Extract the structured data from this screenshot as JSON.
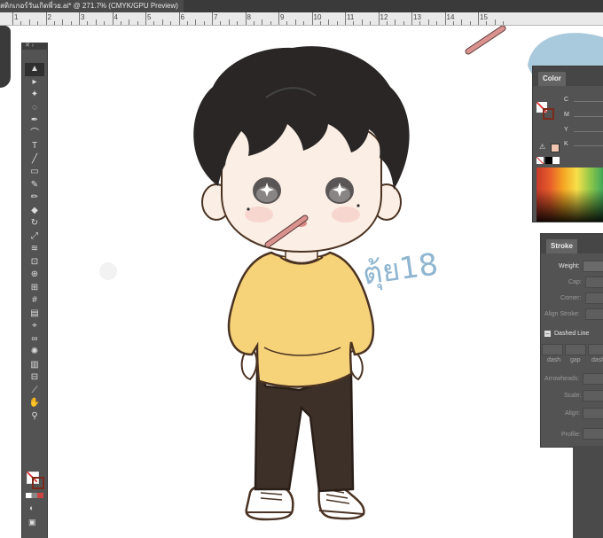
{
  "document_tab": {
    "title": "สติกเกอร์วันเกิดพี่วย.ai* @ 271.7% (CMYK/GPU Preview)"
  },
  "ruler": {
    "numbers": [
      "1",
      "2",
      "3",
      "4",
      "5",
      "6",
      "7",
      "8",
      "9",
      "10",
      "11",
      "12",
      "13",
      "14",
      "15"
    ]
  },
  "tools": {
    "items": [
      {
        "name": "selection-tool",
        "glyph": "▲",
        "selected": true
      },
      {
        "name": "direct-selection-tool",
        "glyph": "▸"
      },
      {
        "name": "magic-wand-tool",
        "glyph": "✦"
      },
      {
        "name": "lasso-tool",
        "glyph": "◌"
      },
      {
        "name": "pen-tool",
        "glyph": "✒"
      },
      {
        "name": "curvature-tool",
        "glyph": "⌒"
      },
      {
        "name": "type-tool",
        "glyph": "T"
      },
      {
        "name": "line-tool",
        "glyph": "╱"
      },
      {
        "name": "rectangle-tool",
        "glyph": "▭"
      },
      {
        "name": "paintbrush-tool",
        "glyph": "✎"
      },
      {
        "name": "pencil-tool",
        "glyph": "✏"
      },
      {
        "name": "eraser-tool",
        "glyph": "◆"
      },
      {
        "name": "rotate-tool",
        "glyph": "↻"
      },
      {
        "name": "scale-tool",
        "glyph": "⤢"
      },
      {
        "name": "warp-tool",
        "glyph": "≋"
      },
      {
        "name": "free-transform-tool",
        "glyph": "⊡"
      },
      {
        "name": "shape-builder-tool",
        "glyph": "⊕"
      },
      {
        "name": "perspective-grid-tool",
        "glyph": "⊞"
      },
      {
        "name": "mesh-tool",
        "glyph": "#"
      },
      {
        "name": "gradient-tool",
        "glyph": "▤"
      },
      {
        "name": "eyedropper-tool",
        "glyph": "⌖"
      },
      {
        "name": "blend-tool",
        "glyph": "∞"
      },
      {
        "name": "symbol-sprayer-tool",
        "glyph": "✺"
      },
      {
        "name": "column-graph-tool",
        "glyph": "▥"
      },
      {
        "name": "artboard-tool",
        "glyph": "⊟"
      },
      {
        "name": "slice-tool",
        "glyph": "⟋"
      },
      {
        "name": "hand-tool",
        "glyph": "✋"
      },
      {
        "name": "zoom-tool",
        "glyph": "⚲"
      }
    ]
  },
  "color_panel": {
    "tab": "Color",
    "channels": [
      "C",
      "M",
      "Y",
      "K"
    ],
    "accent_hex": "#f1c6b0"
  },
  "stroke_panel": {
    "tab": "Stroke",
    "weight_label": "Weight:",
    "cap_label": "Cap:",
    "corner_label": "Corner:",
    "align_label": "Align Stroke:",
    "dashed_label": "Dashed Line",
    "dash_labels": [
      "dash",
      "gap",
      "dash"
    ],
    "arrowheads_label": "Arrowheads:",
    "scale_label": "Scale:",
    "align2_label": "Align:",
    "profile_label": "Profile:"
  },
  "artwork": {
    "handwritten_text": "ตุ้ย18",
    "colors": {
      "hair": "#2a2626",
      "skin": "#fbeee4",
      "shirt": "#f6d279",
      "pants": "#3d3028",
      "outline": "#4a3322",
      "pencil": "#d9928e",
      "blue_shape": "#a9c9dc",
      "handwriting": "#8fb6d0"
    }
  }
}
